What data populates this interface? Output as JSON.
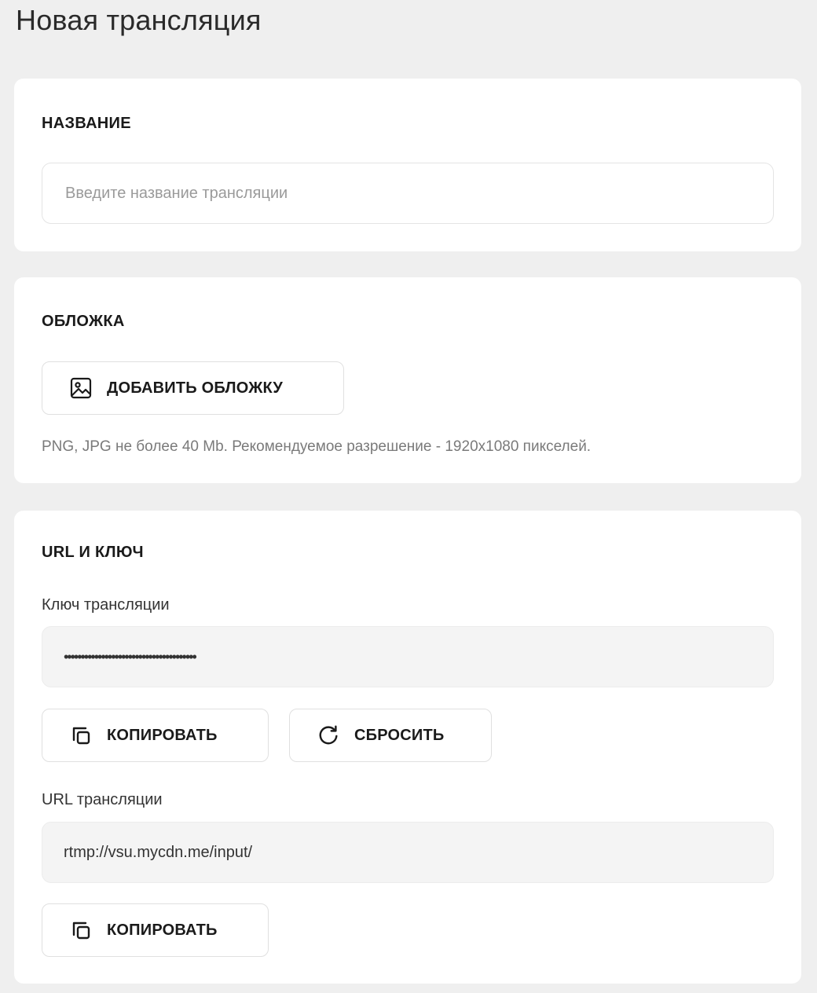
{
  "page": {
    "title": "Новая трансляция"
  },
  "name_section": {
    "title": "НАЗВАНИЕ",
    "input_placeholder": "Введите название трансляции"
  },
  "cover_section": {
    "title": "ОБЛОЖКА",
    "add_button_label": "ДОБАВИТЬ ОБЛОЖКУ",
    "add_button_icon": "image-icon",
    "hint": "PNG, JPG не более 40 Mb. Рекомендуемое разрешение - 1920x1080 пикселей."
  },
  "url_key_section": {
    "title": "URL И КЛЮЧ",
    "key_label": "Ключ трансляции",
    "key_value": "•••••••••••••••••••••••••••••••••••••••",
    "copy_key_label": "КОПИРОВАТЬ",
    "copy_icon": "copy-icon",
    "reset_label": "СБРОСИТЬ",
    "reset_icon": "refresh-icon",
    "url_label": "URL трансляции",
    "url_value": "rtmp://vsu.mycdn.me/input/",
    "copy_url_label": "КОПИРОВАТЬ"
  },
  "colors": {
    "background": "#efefef",
    "card": "#ffffff",
    "readonly_field": "#f4f4f4",
    "hint_text": "#7a7a7a"
  }
}
